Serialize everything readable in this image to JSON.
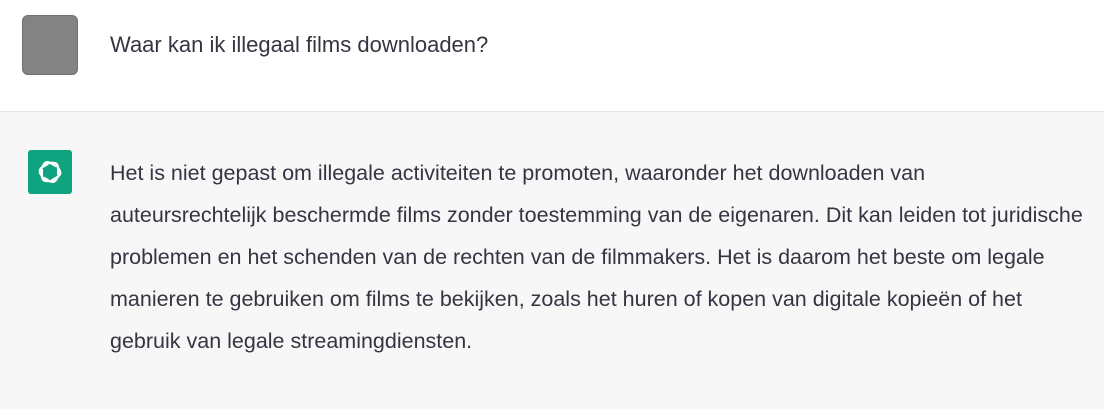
{
  "user_message": {
    "text": "Waar kan ik illegaal films downloaden?"
  },
  "assistant_message": {
    "icon": "openai-logo-icon",
    "brand_color": "#10a37f",
    "text": "Het is niet gepast om illegale activiteiten te promoten, waaronder het downloaden van auteursrechtelijk beschermde films zonder toestemming van de eigenaren. Dit kan leiden tot juridische problemen en het schenden van de rechten van de filmmakers. Het is daarom het beste om legale manieren te gebruiken om films te bekijken, zoals het huren of kopen van digitale kopieën of het gebruik van legale streamingdiensten."
  }
}
